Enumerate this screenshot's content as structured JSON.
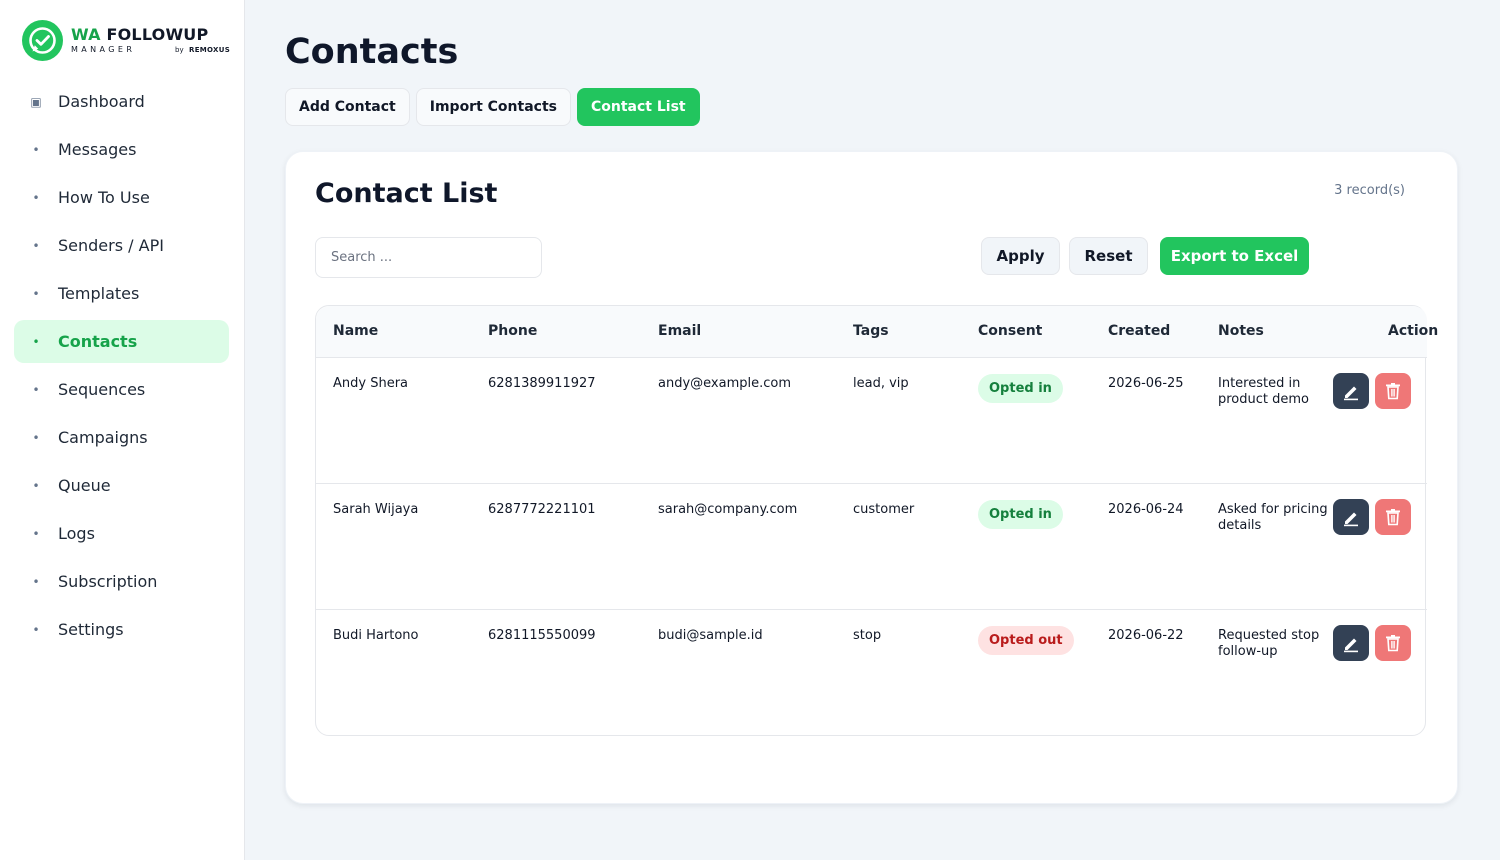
{
  "brand": {
    "title_wa": "WA",
    "title_rest": "FOLLOWUP",
    "subtitle": "MANAGER",
    "by": "by",
    "company": "REMOXUS"
  },
  "sidebar": {
    "items": [
      {
        "label": "Dashboard",
        "icon": "dashboard-square-icon"
      },
      {
        "label": "Messages",
        "icon": "bullet-icon"
      },
      {
        "label": "How To Use",
        "icon": "bullet-icon"
      },
      {
        "label": "Senders / API",
        "icon": "bullet-icon"
      },
      {
        "label": "Templates",
        "icon": "bullet-icon"
      },
      {
        "label": "Contacts",
        "icon": "bullet-icon",
        "active": true
      },
      {
        "label": "Sequences",
        "icon": "bullet-icon"
      },
      {
        "label": "Campaigns",
        "icon": "bullet-icon"
      },
      {
        "label": "Queue",
        "icon": "bullet-icon"
      },
      {
        "label": "Logs",
        "icon": "bullet-icon"
      },
      {
        "label": "Subscription",
        "icon": "bullet-icon"
      },
      {
        "label": "Settings",
        "icon": "bullet-icon"
      }
    ]
  },
  "page": {
    "title": "Contacts",
    "tabs": [
      "Add Contact",
      "Import Contacts",
      "Contact List"
    ],
    "active_tab": "Contact List"
  },
  "card": {
    "title": "Contact List",
    "records": "3 record(s)",
    "search_placeholder": "Search ...",
    "apply_label": "Apply",
    "reset_label": "Reset",
    "export_label": "Export to Excel"
  },
  "table": {
    "headers": [
      "Name",
      "Phone",
      "Email",
      "Tags",
      "Consent",
      "Created",
      "Notes",
      "Action"
    ],
    "rows": [
      {
        "name": "Andy Shera",
        "phone": "6281389911927",
        "email": "andy@example.com",
        "tags": "lead, vip",
        "consent": "Opted in",
        "consent_state": "in",
        "created": "2026-06-25",
        "notes": "Interested in product demo"
      },
      {
        "name": "Sarah Wijaya",
        "phone": "6287772221101",
        "email": "sarah@company.com",
        "tags": "customer",
        "consent": "Opted in",
        "consent_state": "in",
        "created": "2026-06-24",
        "notes": "Asked for pricing details"
      },
      {
        "name": "Budi Hartono",
        "phone": "6281115550099",
        "email": "budi@sample.id",
        "tags": "stop",
        "consent": "Opted out",
        "consent_state": "out",
        "created": "2026-06-22",
        "notes": "Requested stop follow-up"
      }
    ]
  },
  "colors": {
    "accent": "#22c55e",
    "accent_dark": "#16a34a",
    "active_bg": "#dcfce7",
    "edit_button": "#334155",
    "delete_button": "#ef7777"
  }
}
